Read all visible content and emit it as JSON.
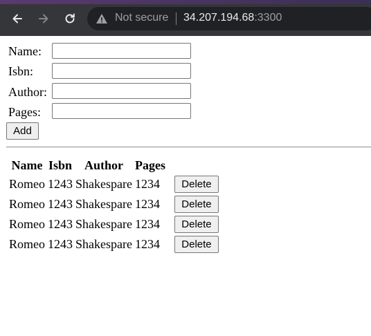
{
  "browser": {
    "security_label": "Not secure",
    "url_host": "34.207.194.68",
    "url_port": ":3300",
    "icons": {
      "back": "back-arrow-icon",
      "forward": "forward-arrow-icon",
      "reload": "reload-icon",
      "security": "warning-triangle-icon"
    }
  },
  "form": {
    "name_label": "Name:",
    "isbn_label": "Isbn:",
    "author_label": "Author:",
    "pages_label": "Pages:",
    "name_value": "",
    "isbn_value": "",
    "author_value": "",
    "pages_value": "",
    "add_label": "Add"
  },
  "table": {
    "headers": [
      "Name",
      "Isbn",
      "Author",
      "Pages"
    ],
    "rows": [
      {
        "name": "Romeo",
        "isbn": "1243",
        "author": "Shakespare",
        "pages": "1234",
        "action": "Delete"
      },
      {
        "name": "Romeo",
        "isbn": "1243",
        "author": "Shakespare",
        "pages": "1234",
        "action": "Delete"
      },
      {
        "name": "Romeo",
        "isbn": "1243",
        "author": "Shakespare",
        "pages": "1234",
        "action": "Delete"
      },
      {
        "name": "Romeo",
        "isbn": "1243",
        "author": "Shakespare",
        "pages": "1234",
        "action": "Delete"
      }
    ]
  },
  "colors": {
    "toolbar": "#35363a",
    "omnibox": "#202124",
    "button_bg": "#efefef"
  }
}
